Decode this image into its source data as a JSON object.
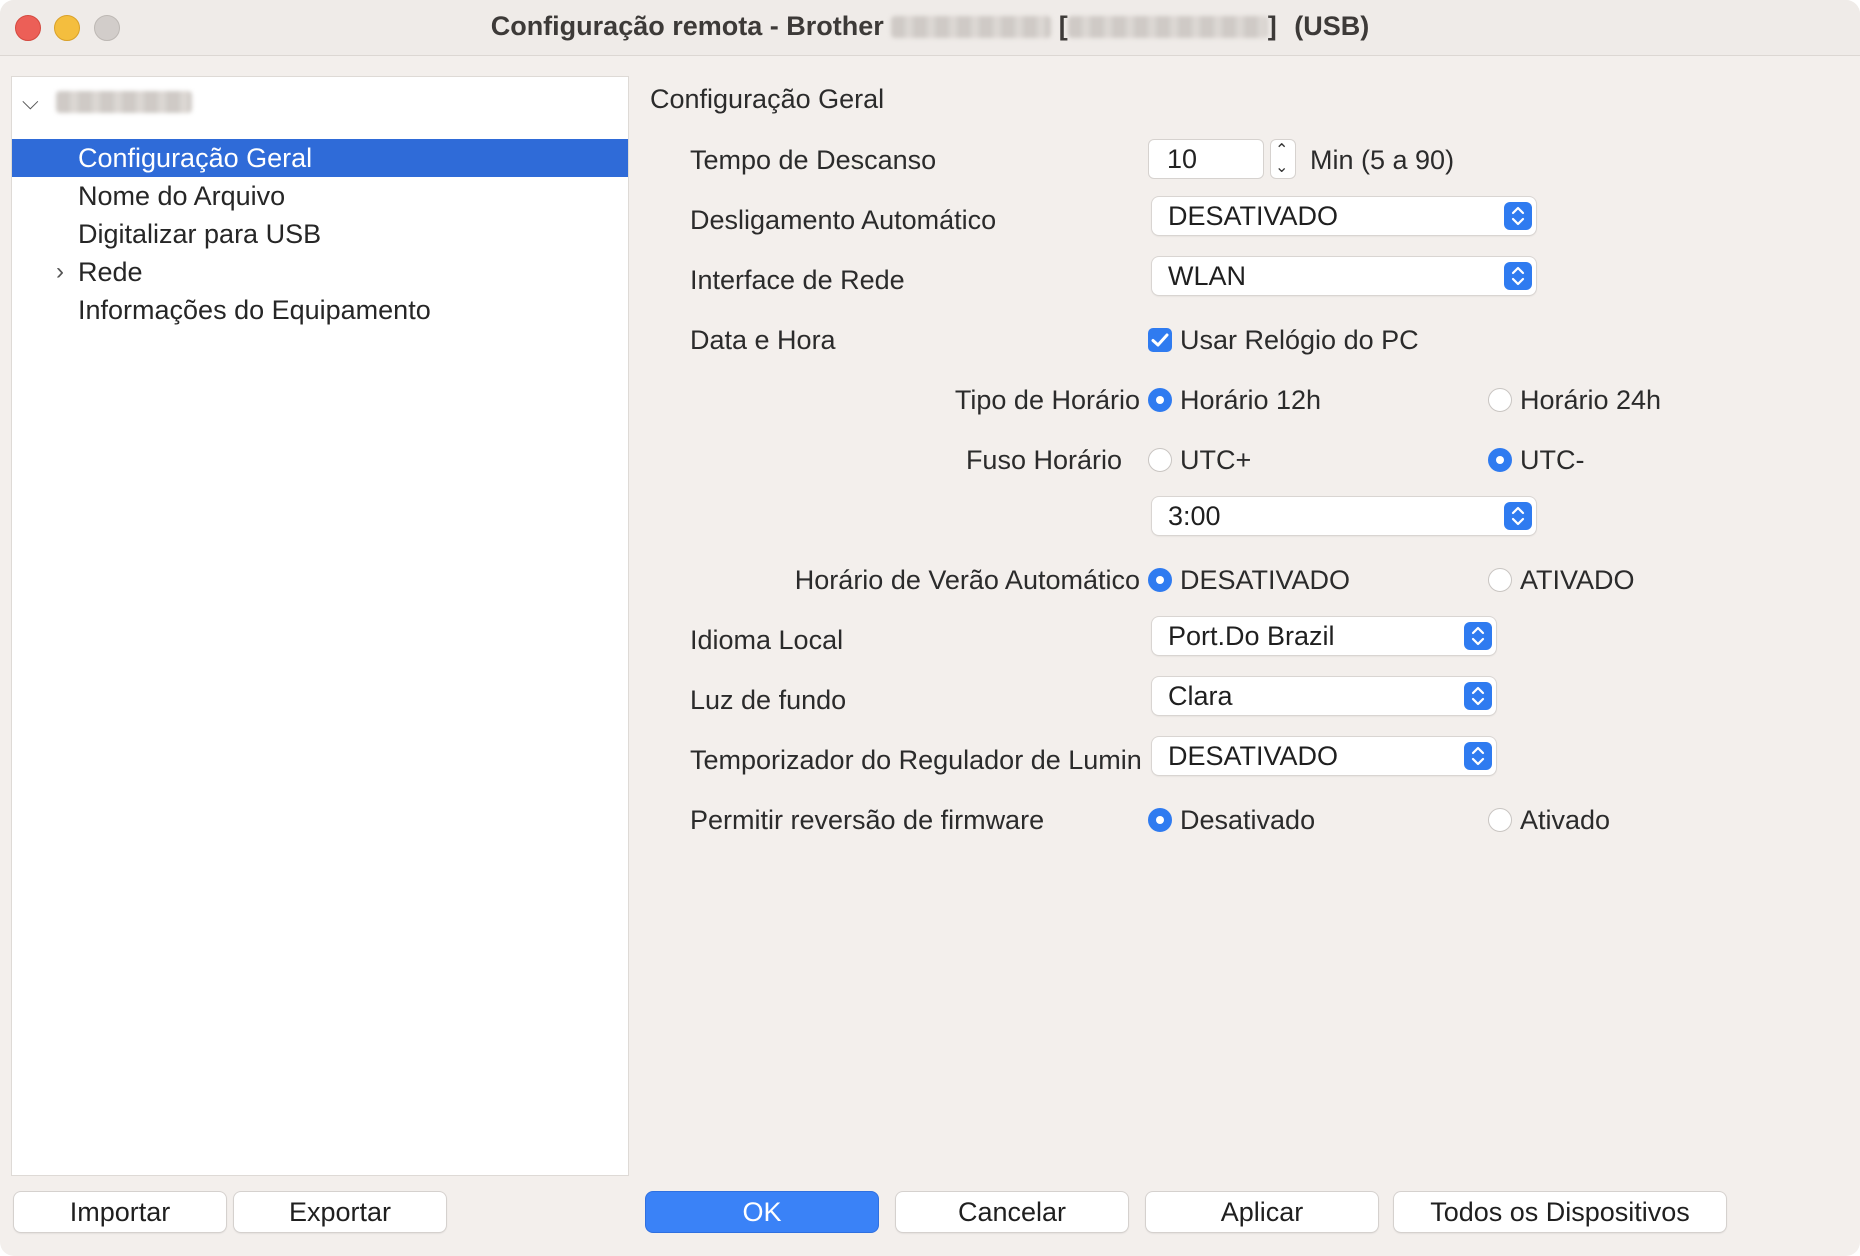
{
  "window": {
    "title_prefix": "Configuração remota - Brother",
    "title_bracket_open": "[",
    "title_bracket_close": "]",
    "title_suffix": "(USB)"
  },
  "sidebar": {
    "items": [
      {
        "label": "Configuração Geral",
        "selected": true
      },
      {
        "label": "Nome do Arquivo"
      },
      {
        "label": "Digitalizar para USB"
      },
      {
        "label": "Rede",
        "expandable": true
      },
      {
        "label": "Informações do Equipamento"
      }
    ]
  },
  "main": {
    "section_title": "Configuração Geral",
    "sleep": {
      "label": "Tempo de Descanso",
      "value": "10",
      "unit": "Min (5 a 90)"
    },
    "auto_off": {
      "label": "Desligamento Automático",
      "value": "DESATIVADO"
    },
    "net_if": {
      "label": "Interface de Rede",
      "value": "WLAN"
    },
    "datetime": {
      "label": "Data e Hora",
      "checkbox_label": "Usar Relógio do PC",
      "checked": true
    },
    "clock_type": {
      "label": "Tipo de Horário",
      "opt1": "Horário 12h",
      "opt2": "Horário 24h",
      "selected": "opt1"
    },
    "timezone": {
      "label": "Fuso Horário",
      "opt1": "UTC+",
      "opt2": "UTC-",
      "selected": "opt2",
      "value": "3:00"
    },
    "dst": {
      "label": "Horário de Verão Automático",
      "opt1": "DESATIVADO",
      "opt2": "ATIVADO",
      "selected": "opt1"
    },
    "language": {
      "label": "Idioma Local",
      "value": "Port.Do Brazil"
    },
    "backlight": {
      "label": "Luz de fundo",
      "value": "Clara"
    },
    "dim_timer": {
      "label": "Temporizador do Regulador de Lumin",
      "value": "DESATIVADO"
    },
    "fw_rollback": {
      "label": "Permitir reversão de firmware",
      "opt1": "Desativado",
      "opt2": "Ativado",
      "selected": "opt1"
    }
  },
  "footer": {
    "import": "Importar",
    "export": "Exportar",
    "ok": "OK",
    "cancel": "Cancelar",
    "apply": "Aplicar",
    "all_devices": "Todos os Dispositivos"
  },
  "colors": {
    "accent": "#2f7bf0",
    "selection": "#2f6bd8",
    "window_bg": "#f3efec"
  }
}
